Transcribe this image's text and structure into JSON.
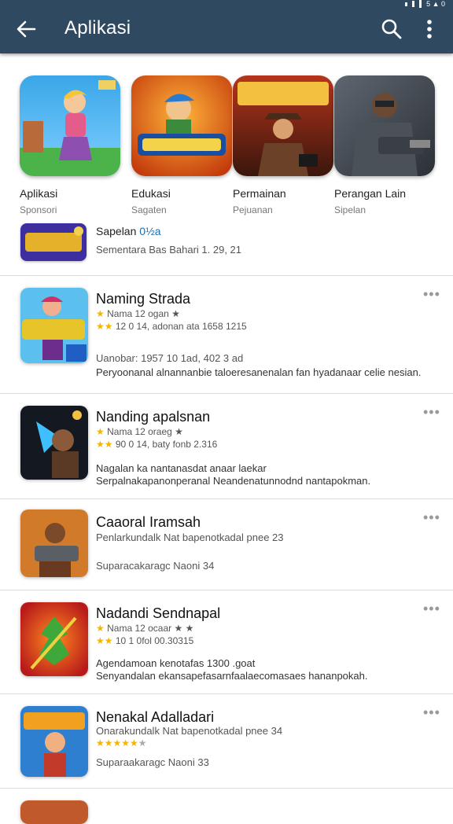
{
  "appbar": {
    "title": "Aplikasi",
    "status_text": "5 ▲ 0"
  },
  "icons": {
    "back": "arrow-left-icon",
    "search": "search-icon",
    "more": "more-vert-icon",
    "row_more": "more-horiz-icon"
  },
  "featured": [
    {
      "name": "Aplikasi",
      "sub": "Sponsori"
    },
    {
      "name": "Edukasi",
      "sub": "Sagaten"
    },
    {
      "name": "Permainan",
      "sub": "Pejuanan"
    },
    {
      "name": "Perangan Lain",
      "sub": "Sipelan"
    }
  ],
  "promo": {
    "title": "Sapelan",
    "title_accent": "0½a",
    "subtitle": "Sementara Bas Bahari 1. 29, 21"
  },
  "list": [
    {
      "title": "Naming Strada",
      "line1": "Nama 12 ogan ★",
      "line2": "12 0 14, adonan ata 1658 1215",
      "line3": "Uanobar: 1957 10 1ad, 402 3 ad",
      "desc": "Peryoonanal alnannanbie taloeresanenalan fan hyadanaar celie nesian."
    },
    {
      "title": "Nanding apalsnan",
      "line1": "Nama 12 oraeg ★",
      "line2": "90 0 14, baty fonb 2.316",
      "line3": "Nagalan ka nantanasdat anaar laekar",
      "desc": "Serpalnakapanonperanal Neandenatunnodnd nantapokman."
    },
    {
      "title": "Caaoral Iramsah",
      "line1": "Penlarkundalk Nat bapenotkadal pnee 23",
      "line2": "",
      "line3": "Suparacakaragc Naoni 34",
      "desc": ""
    },
    {
      "title": "Nadandi Sendnapal",
      "line1": "Nama 12 ocaar ★ ★",
      "line2": "10 1 0fol 00.30315",
      "line3": "Agendamoan kenotafas 1300 .goat",
      "desc": "Senyandalan ekansapefasarnfaalaecomasaes hananpokah."
    },
    {
      "title": "Nenakal Adalladari",
      "line1": "Onarakundalk Nat bapenotkadal pnee 34",
      "line2": "",
      "line3": "Suparaakaragc Naoni 33",
      "desc": ""
    }
  ],
  "colors": {
    "appbar": "#2f4a60",
    "star": "#f2b500",
    "accent": "#1a6fb0"
  }
}
